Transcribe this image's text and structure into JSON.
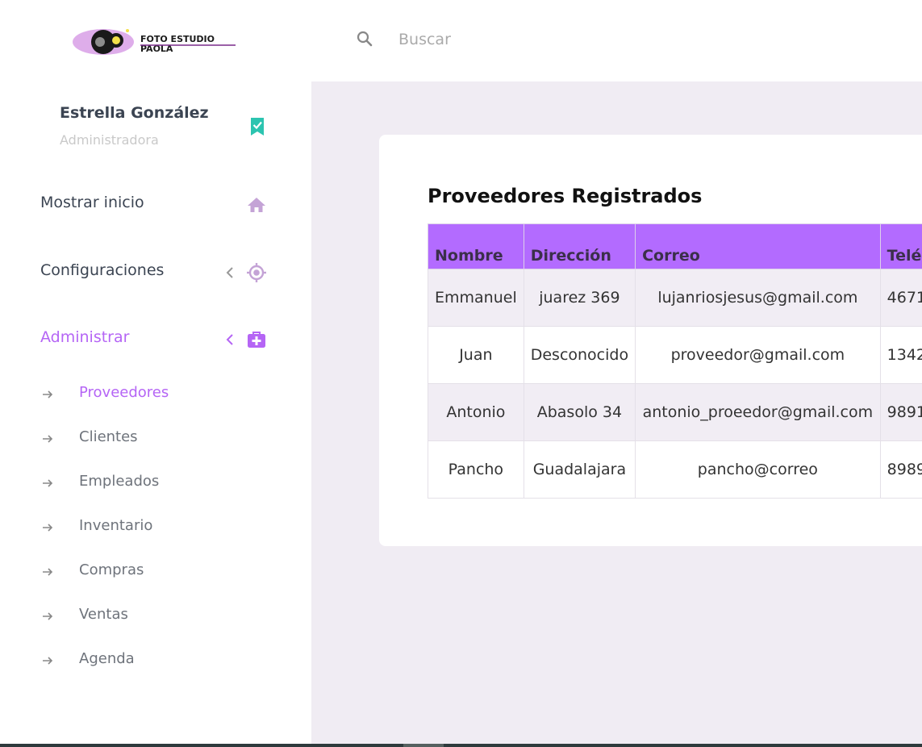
{
  "brand": {
    "logo_text": "FOTO ESTUDIO PAOLA"
  },
  "search": {
    "placeholder": "Buscar",
    "icon": "search-icon"
  },
  "user": {
    "name": "Estrella González",
    "role": "Administradora",
    "badge_icon": "bookmark-check-icon"
  },
  "nav": {
    "home": {
      "label": "Mostrar inicio",
      "icon": "home-icon"
    },
    "settings": {
      "label": "Configuraciones",
      "icon": "crosshair-icon"
    },
    "admin": {
      "label": "Administrar",
      "icon": "medical-bag-icon"
    },
    "sub_items": [
      {
        "label": "Proveedores"
      },
      {
        "label": "Clientes"
      },
      {
        "label": "Empleados"
      },
      {
        "label": "Inventario"
      },
      {
        "label": "Compras"
      },
      {
        "label": "Ventas"
      },
      {
        "label": "Agenda"
      }
    ]
  },
  "main": {
    "title": "Proveedores Registrados",
    "table": {
      "headers": [
        "Nombre",
        "Dirección",
        "Correo",
        "Telé"
      ],
      "rows": [
        [
          "Emmanuel",
          "juarez 369",
          "lujanriosjesus@gmail.com",
          "4671"
        ],
        [
          "Juan",
          "Desconocido",
          "proveedor@gmail.com",
          "1342"
        ],
        [
          "Antonio",
          "Abasolo 34",
          "antonio_proeedor@gmail.com",
          "9891"
        ],
        [
          "Pancho",
          "Guadalajara",
          "pancho@correo",
          "8989"
        ]
      ]
    }
  },
  "colors": {
    "accent": "#b565f5",
    "table_header": "#b36bff",
    "badge": "#2cc4b0",
    "content_bg": "#f0ecf3",
    "icon_muted": "#c4a3d6"
  }
}
